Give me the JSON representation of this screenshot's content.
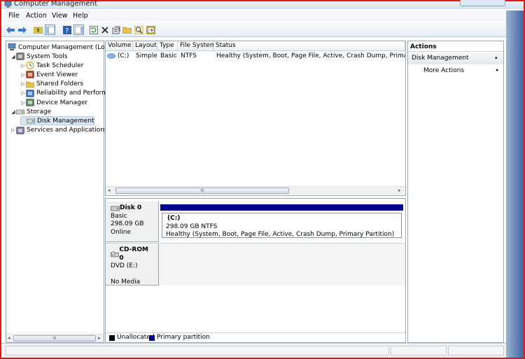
{
  "window": {
    "title": "Computer Management"
  },
  "menu": [
    "File",
    "Action",
    "View",
    "Help"
  ],
  "tree": {
    "root": "Computer Management (Local",
    "items": [
      {
        "label": "System Tools",
        "level": 1,
        "expanded": true,
        "icon": "tools-icon"
      },
      {
        "label": "Task Scheduler",
        "level": 2,
        "icon": "clock-icon"
      },
      {
        "label": "Event Viewer",
        "level": 2,
        "icon": "event-viewer-icon"
      },
      {
        "label": "Shared Folders",
        "level": 2,
        "icon": "shared-folder-icon"
      },
      {
        "label": "Reliability and Performa",
        "level": 2,
        "icon": "performance-icon"
      },
      {
        "label": "Device Manager",
        "level": 2,
        "icon": "device-manager-icon"
      },
      {
        "label": "Storage",
        "level": 1,
        "expanded": true,
        "icon": "storage-icon"
      },
      {
        "label": "Disk Management",
        "level": 2,
        "selected": true,
        "icon": "disk-icon"
      },
      {
        "label": "Services and Applications",
        "level": 1,
        "icon": "services-icon"
      }
    ],
    "scroll_grip": "III"
  },
  "volume_table": {
    "columns": [
      "Volume",
      "Layout",
      "Type",
      "File System",
      "Status"
    ],
    "rows": [
      {
        "volume": "(C:)",
        "layout": "Simple",
        "type": "Basic",
        "fs": "NTFS",
        "status": "Healthy (System, Boot, Page File, Active, Crash Dump, Primary Partitio"
      }
    ],
    "scroll_grip": "III"
  },
  "disks": [
    {
      "name": "Disk 0",
      "type": "Basic",
      "size": "298.09 GB",
      "state": "Online",
      "partition": {
        "name": "(C:)",
        "size_fs": "298.09 GB NTFS",
        "status": "Healthy (System, Boot, Page File, Active, Crash Dump, Primary Partition)"
      }
    },
    {
      "name": "CD-ROM 0",
      "type": "DVD (E:)",
      "state": "No Media"
    }
  ],
  "legend": [
    {
      "label": "Unallocated",
      "color": "#000000"
    },
    {
      "label": "Primary partition",
      "color": "#00008b"
    }
  ],
  "actions": {
    "title": "Actions",
    "section": "Disk Management",
    "items": [
      "More Actions"
    ]
  },
  "colors": {
    "accent": "#00008b",
    "border": "#e01818"
  }
}
